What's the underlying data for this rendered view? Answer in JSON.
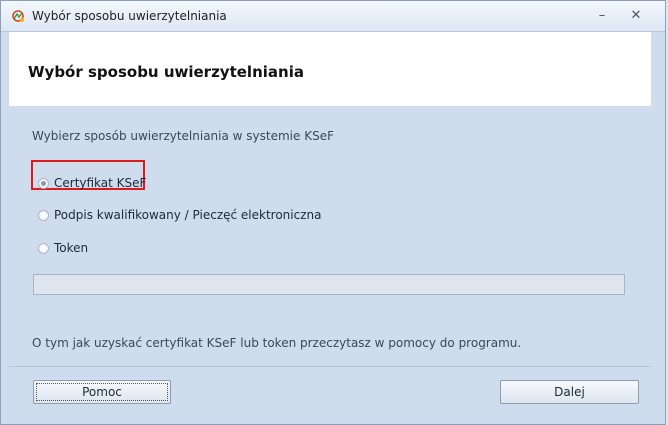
{
  "window": {
    "title": "Wybór sposobu uwierzytelniania",
    "minimize_symbol": "–",
    "close_symbol": "✕"
  },
  "header": {
    "heading": "Wybór sposobu uwierzytelniania"
  },
  "main": {
    "prompt": "Wybierz sposób uwierzytelniania w systemie KSeF",
    "options": [
      {
        "label": "Certyfikat KSeF",
        "selected": true
      },
      {
        "label": "Podpis kwalifikowany / Pieczęć elektroniczna",
        "selected": false
      },
      {
        "label": "Token",
        "selected": false
      }
    ],
    "input_value": "",
    "info": "O tym jak uzyskać certyfikat KSeF lub token przeczytasz w pomocy do programu."
  },
  "footer": {
    "help_label": "Pomoc",
    "next_label": "Dalej"
  },
  "colors": {
    "highlight": "#e01a1a",
    "panel": "#cfdced"
  }
}
